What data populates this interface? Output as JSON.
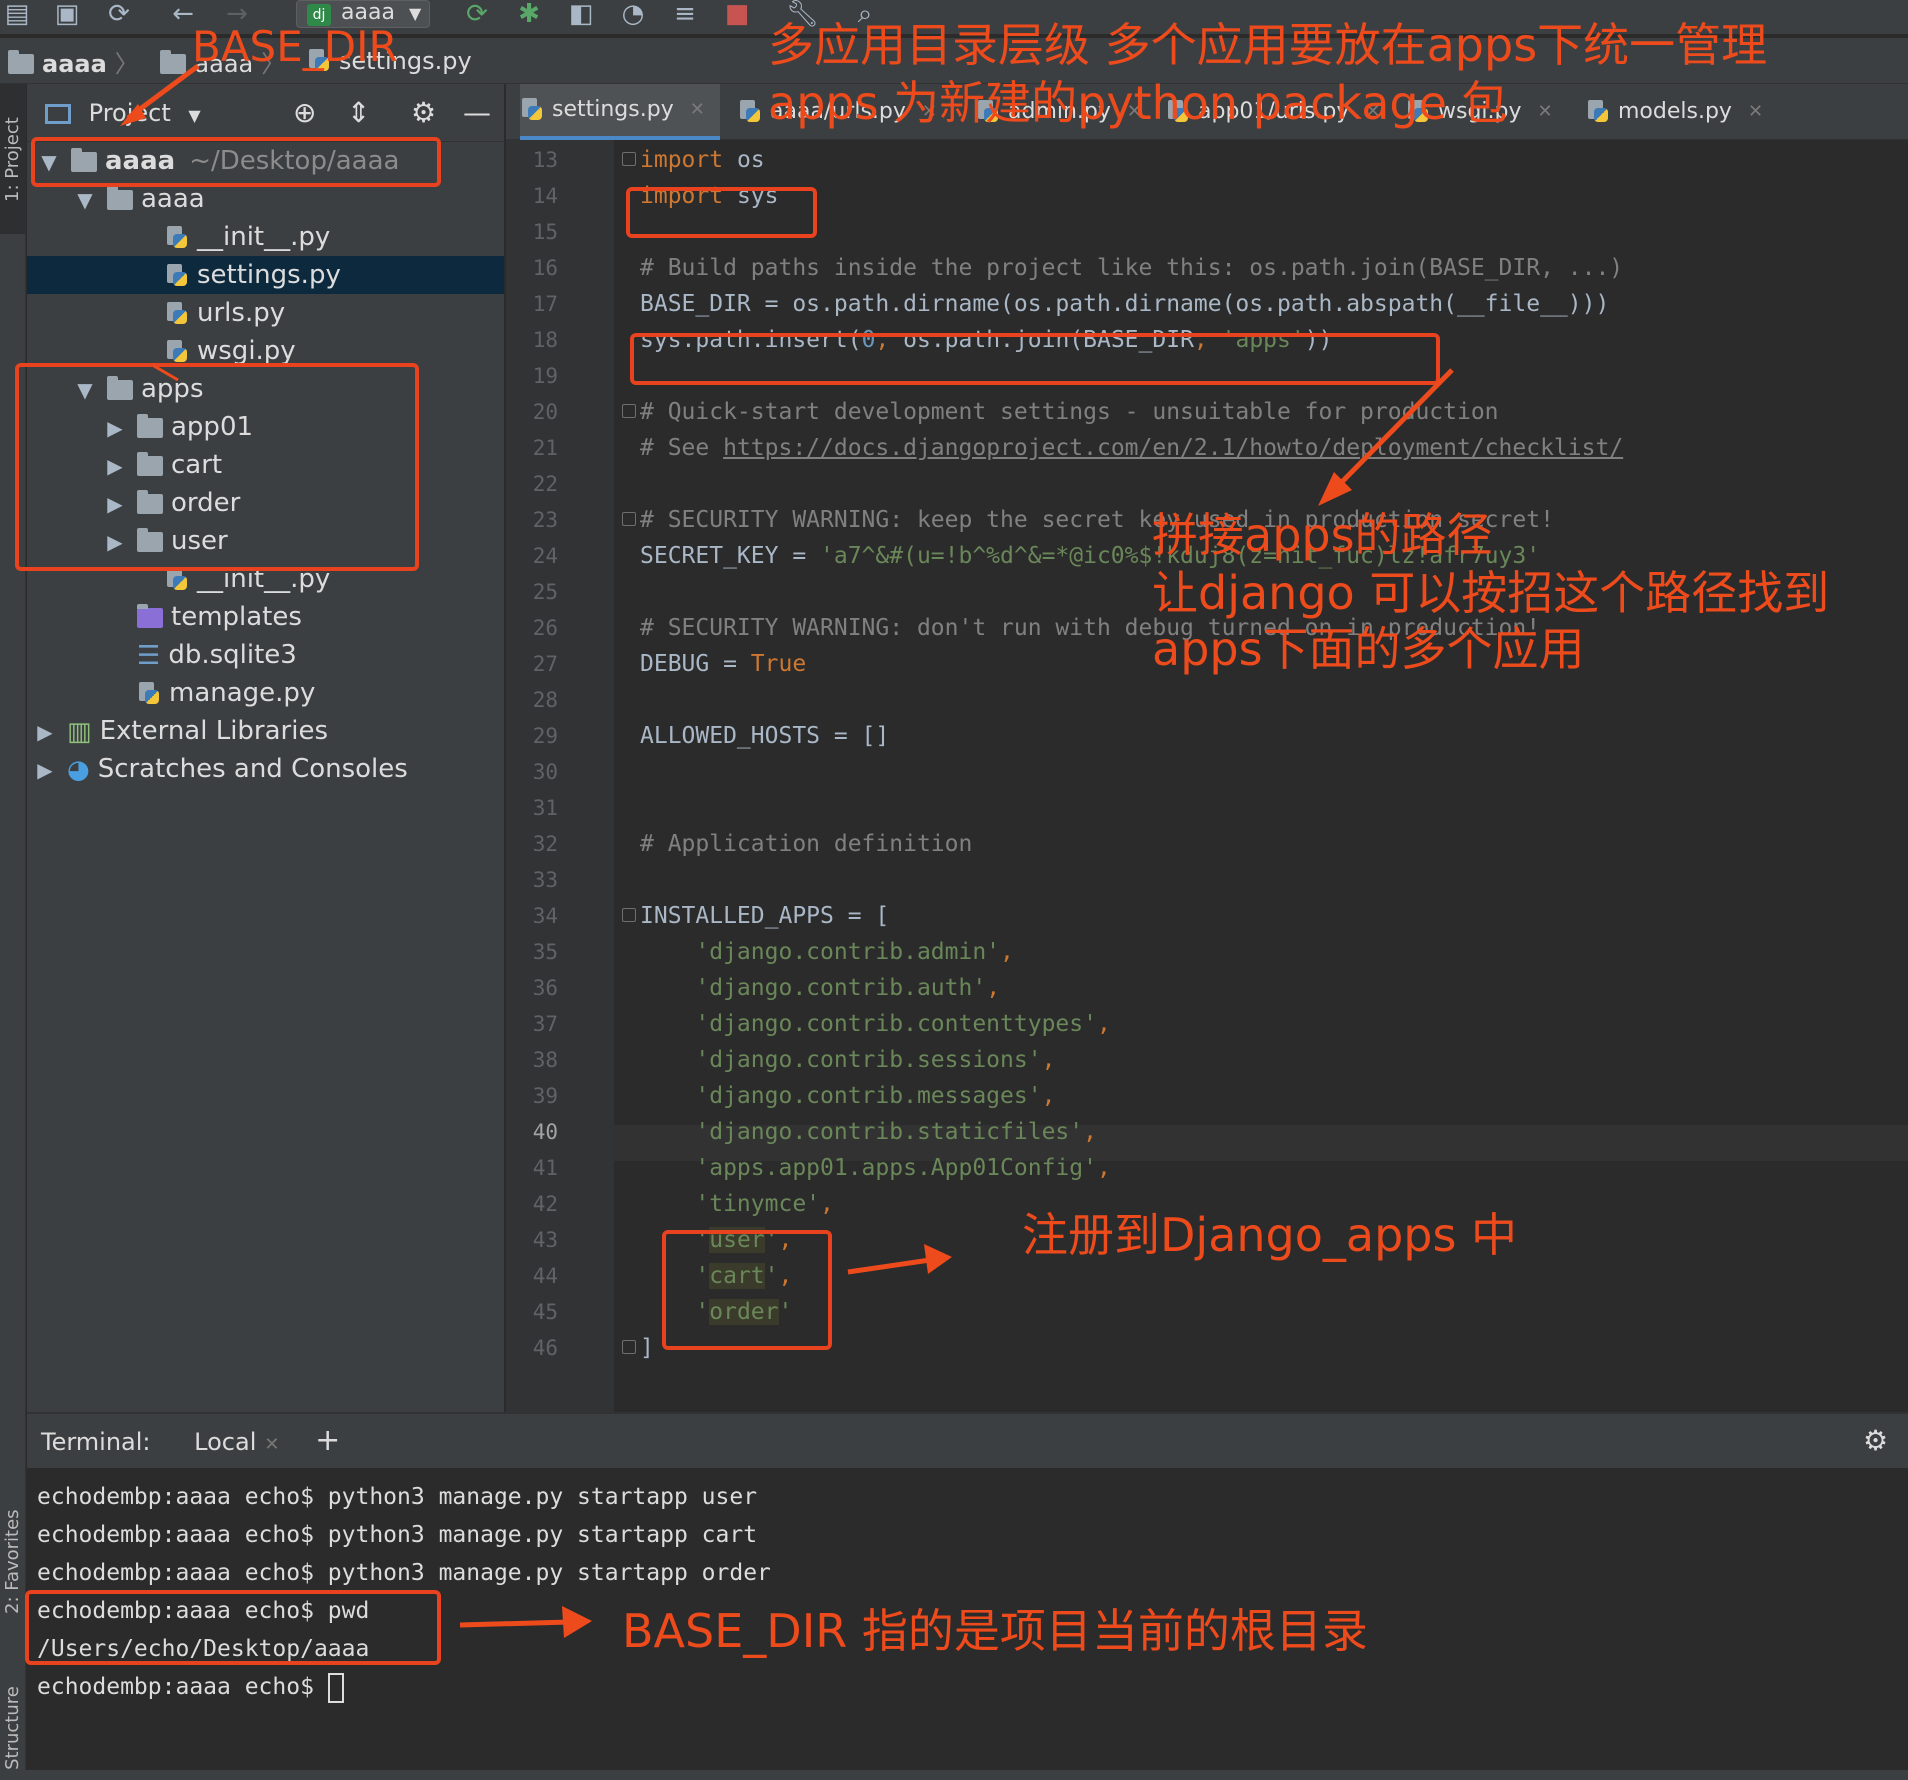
{
  "toolbar": {
    "run_config": "aaaa",
    "run_config_badge": "dj"
  },
  "breadcrumb": [
    "aaaa",
    "aaaa",
    "settings.py"
  ],
  "tool_strip": {
    "project": "1: Project",
    "favorites": "2: Favorites",
    "structure": "Z: Structure"
  },
  "project_panel": {
    "title": "Project",
    "tree": [
      {
        "label": "aaaa",
        "hint": "~/Desktop/aaaa",
        "type": "folder",
        "arrow": "▼"
      },
      {
        "label": "aaaa",
        "type": "folder",
        "arrow": "▼"
      },
      {
        "label": "__init__.py",
        "type": "py"
      },
      {
        "label": "settings.py",
        "type": "py",
        "selected": true
      },
      {
        "label": "urls.py",
        "type": "py"
      },
      {
        "label": "wsgi.py",
        "type": "py"
      },
      {
        "label": "apps",
        "type": "folder",
        "arrow": "▼"
      },
      {
        "label": "app01",
        "type": "folder",
        "arrow": "▶"
      },
      {
        "label": "cart",
        "type": "folder",
        "arrow": "▶"
      },
      {
        "label": "order",
        "type": "folder",
        "arrow": "▶"
      },
      {
        "label": "user",
        "type": "folder",
        "arrow": "▶"
      },
      {
        "label": "__init__.py",
        "type": "py"
      },
      {
        "label": "templates",
        "type": "folder-purple"
      },
      {
        "label": "db.sqlite3",
        "type": "db"
      },
      {
        "label": "manage.py",
        "type": "py"
      },
      {
        "label": "External Libraries",
        "type": "lib",
        "arrow": "▶"
      },
      {
        "label": "Scratches and Consoles",
        "type": "scratch",
        "arrow": "▶"
      }
    ]
  },
  "editor_tabs": [
    {
      "label": "settings.py",
      "active": true
    },
    {
      "label": "aaaa/urls.py"
    },
    {
      "label": "admin.py"
    },
    {
      "label": "app01/urls.py"
    },
    {
      "label": "wsgi.py"
    },
    {
      "label": "models.py"
    }
  ],
  "editor": {
    "current_line": "40",
    "lines": [
      {
        "n": "13",
        "code": "import os"
      },
      {
        "n": "14",
        "code": "import sys"
      },
      {
        "n": "15",
        "code": ""
      },
      {
        "n": "16",
        "code": "# Build paths inside the project like this: os.path.join(BASE_DIR, ...)"
      },
      {
        "n": "17",
        "code": "BASE_DIR = os.path.dirname(os.path.dirname(os.path.abspath(__file__)))"
      },
      {
        "n": "18",
        "code": "sys.path.insert(0, os.path.join(BASE_DIR, 'apps'))"
      },
      {
        "n": "19",
        "code": ""
      },
      {
        "n": "20",
        "code": "# Quick-start development settings - unsuitable for production"
      },
      {
        "n": "21",
        "code": "# See https://docs.djangoproject.com/en/2.1/howto/deployment/checklist/"
      },
      {
        "n": "22",
        "code": ""
      },
      {
        "n": "23",
        "code": "# SECURITY WARNING: keep the secret key used in production secret!"
      },
      {
        "n": "24",
        "code": "SECRET_KEY = 'a7^&#(u=!b^%d^&=*@ic0%$!kduj8(z=hit_fuc)lz!afr7uy3'"
      },
      {
        "n": "25",
        "code": ""
      },
      {
        "n": "26",
        "code": "# SECURITY WARNING: don't run with debug turned on in production!"
      },
      {
        "n": "27",
        "code": "DEBUG = True"
      },
      {
        "n": "28",
        "code": ""
      },
      {
        "n": "29",
        "code": "ALLOWED_HOSTS = []"
      },
      {
        "n": "30",
        "code": ""
      },
      {
        "n": "31",
        "code": ""
      },
      {
        "n": "32",
        "code": "# Application definition"
      },
      {
        "n": "33",
        "code": ""
      },
      {
        "n": "34",
        "code": "INSTALLED_APPS = ["
      },
      {
        "n": "35",
        "code": "    'django.contrib.admin',"
      },
      {
        "n": "36",
        "code": "    'django.contrib.auth',"
      },
      {
        "n": "37",
        "code": "    'django.contrib.contenttypes',"
      },
      {
        "n": "38",
        "code": "    'django.contrib.sessions',"
      },
      {
        "n": "39",
        "code": "    'django.contrib.messages',"
      },
      {
        "n": "40",
        "code": "    'django.contrib.staticfiles',"
      },
      {
        "n": "41",
        "code": "    'apps.app01.apps.App01Config',"
      },
      {
        "n": "42",
        "code": "    'tinymce',"
      },
      {
        "n": "43",
        "code": "    'user',"
      },
      {
        "n": "44",
        "code": "    'cart',"
      },
      {
        "n": "45",
        "code": "    'order'"
      },
      {
        "n": "46",
        "code": "]"
      }
    ]
  },
  "terminal": {
    "label": "Terminal:",
    "tab": "Local",
    "lines": [
      "echodembp:aaaa echo$ python3 manage.py startapp user",
      "echodembp:aaaa echo$ python3 manage.py startapp cart",
      "echodembp:aaaa echo$ python3 manage.py startapp order",
      "echodembp:aaaa echo$ pwd",
      "/Users/echo/Desktop/aaaa",
      "echodembp:aaaa echo$ "
    ]
  },
  "annotations": {
    "base_dir_label": "BASE_DIR",
    "top_note_1": "多应用目录层级 多个应用要放在apps下统一管理",
    "top_note_2": "apps 为新建的python package 包",
    "path_note_1": "拼接apps的路径",
    "path_note_2": "让django 可以按招这个路径找到",
    "path_note_3": "apps下面的多个应用",
    "register_note": "注册到Django_apps 中",
    "base_dir_note": "BASE_DIR  指的是项目当前的根目录",
    "color": "#ee4b1d"
  }
}
